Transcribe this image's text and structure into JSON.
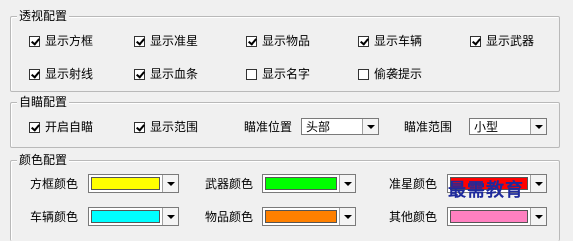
{
  "sections": {
    "perspective": {
      "title": "透视配置",
      "options": [
        {
          "label": "显示方框",
          "checked": true
        },
        {
          "label": "显示准星",
          "checked": true
        },
        {
          "label": "显示物品",
          "checked": true
        },
        {
          "label": "显示车辆",
          "checked": true
        },
        {
          "label": "显示武器",
          "checked": true
        },
        {
          "label": "显示射线",
          "checked": true
        },
        {
          "label": "显示血条",
          "checked": true
        },
        {
          "label": "显示名字",
          "checked": false
        },
        {
          "label": "偷袭提示",
          "checked": false
        }
      ]
    },
    "aim": {
      "title": "自瞄配置",
      "options": [
        {
          "label": "开启自瞄",
          "checked": true
        },
        {
          "label": "显示范围",
          "checked": true
        }
      ],
      "aim_position_label": "瞄准位置",
      "aim_position_value": "头部",
      "aim_range_label": "瞄准范围",
      "aim_range_value": "小型"
    },
    "colors": {
      "title": "颜色配置",
      "items": [
        {
          "label": "方框颜色",
          "color": "#ffff00"
        },
        {
          "label": "武器颜色",
          "color": "#00ff00"
        },
        {
          "label": "准星颜色",
          "color": "#ff0000"
        },
        {
          "label": "车辆颜色",
          "color": "#00ffff"
        },
        {
          "label": "物品颜色",
          "color": "#ff8000"
        },
        {
          "label": "其他颜色",
          "color": "#ff80c0"
        }
      ]
    }
  },
  "watermark": "最需教育"
}
